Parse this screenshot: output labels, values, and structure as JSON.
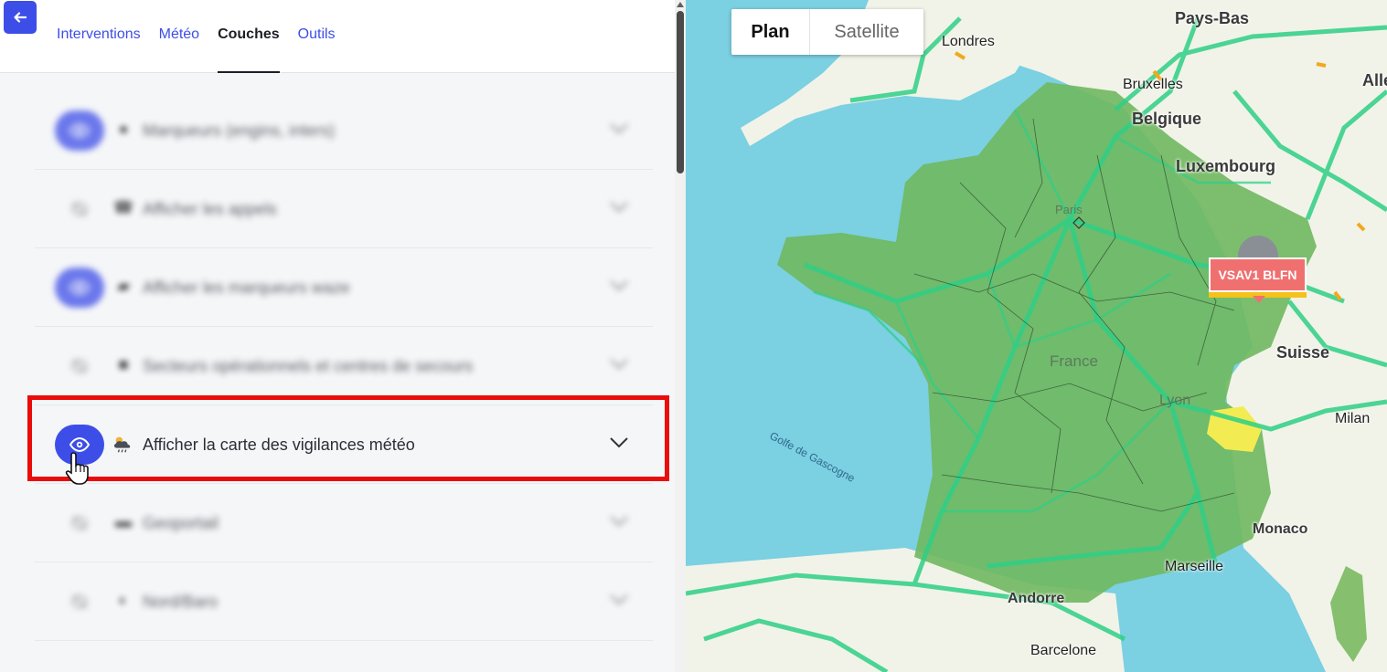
{
  "header": {
    "back_icon": "arrow-left-icon",
    "tabs": [
      {
        "label": "Interventions",
        "active": false
      },
      {
        "label": "Météo",
        "active": false
      },
      {
        "label": "Couches",
        "active": true
      },
      {
        "label": "Outils",
        "active": false
      }
    ]
  },
  "layers": [
    {
      "label": "Marqueurs (engins, inters)",
      "icon": "map-pin-icon",
      "enabled": true,
      "blurred": true
    },
    {
      "label": "Afficher les appels",
      "icon": "phone-icon",
      "enabled": false,
      "blurred": true
    },
    {
      "label": "Afficher les marqueurs waze",
      "icon": "chat-bubbles-icon",
      "enabled": true,
      "blurred": true
    },
    {
      "label": "Secteurs opérationnels et centres de secours",
      "icon": "truck-icon",
      "enabled": false,
      "blurred": true
    },
    {
      "label": "Afficher la carte des vigilances météo",
      "icon": "cloud-sun-rain-icon",
      "enabled": true,
      "blurred": false
    },
    {
      "label": "Geoportail",
      "icon": "card-icon",
      "enabled": false,
      "blurred": true
    },
    {
      "label": "Nord/Baro",
      "icon": "moon-icon",
      "enabled": false,
      "blurred": true
    }
  ],
  "map": {
    "mode_toggle": {
      "plan": "Plan",
      "satellite": "Satellite",
      "selected": "Plan"
    },
    "labels": {
      "pays_bas": "Pays-Bas",
      "londres": "Londres",
      "bruxelles": "Bruxelles",
      "belgique": "Belgique",
      "luxembourg": "Luxembourg",
      "alle": "Alle",
      "suisse": "Suisse",
      "france": "France",
      "lyon": "Lyon",
      "milan": "Milan",
      "monaco": "Monaco",
      "marseille": "Marseille",
      "andorre": "Andorre",
      "barcelone": "Barcelone",
      "golfe": "Golfe de Gascogne",
      "paris": "Paris"
    },
    "unit_marker": {
      "label": "VSAV1 BLFN"
    }
  },
  "colors": {
    "accent": "#3d4ee8",
    "highlight": "#ea0b0b",
    "sea": "#7bd0e2",
    "vigilance_green": "#6fb85f",
    "vigilance_yellow": "#f2ec52",
    "unit_marker": "#f07070"
  }
}
